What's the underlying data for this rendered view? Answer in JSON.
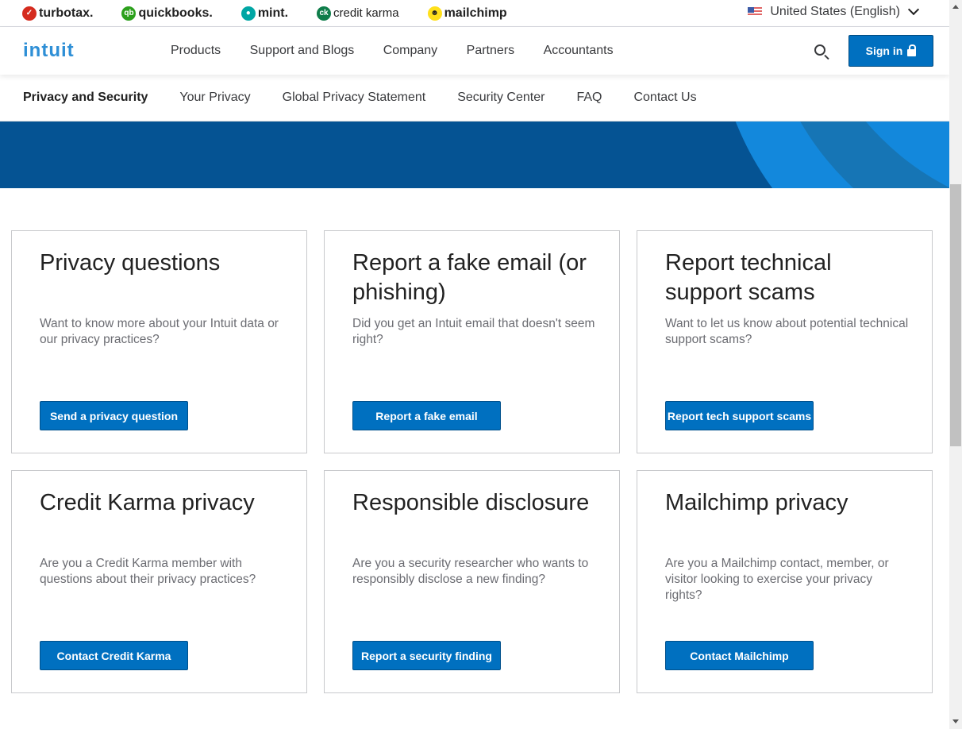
{
  "brands": [
    {
      "label": "turbotax.",
      "color": "#d52b1e",
      "glyph": "✓"
    },
    {
      "label": "quickbooks.",
      "color": "#2ca01c",
      "glyph": "qb"
    },
    {
      "label": "mint.",
      "color": "#00a6a4",
      "glyph": "●"
    },
    {
      "label": "credit karma",
      "color": "#0f7d4a",
      "glyph": "ck"
    },
    {
      "label": "mailchimp",
      "color": "#ffe01b",
      "glyph": "☻"
    }
  ],
  "locale": "United States (English)",
  "header": {
    "logo": "intuit",
    "nav": [
      "Products",
      "Support and Blogs",
      "Company",
      "Partners",
      "Accountants"
    ],
    "signin": "Sign in"
  },
  "subnav": [
    "Privacy and Security",
    "Your Privacy",
    "Global Privacy Statement",
    "Security Center",
    "FAQ",
    "Contact Us"
  ],
  "cards": [
    {
      "title": "Privacy questions",
      "text": "Want to know more about your Intuit data or our privacy practices?",
      "button": "Send a privacy question"
    },
    {
      "title": "Report a fake email (or phishing)",
      "text": "Did you get an Intuit email that doesn't seem right?",
      "button": "Report a fake email"
    },
    {
      "title": "Report technical support scams",
      "text": "Want to let us know about potential technical support scams?",
      "button": "Report tech support scams"
    },
    {
      "title": "Credit Karma privacy",
      "text": "Are you a Credit Karma member with questions about their privacy practices?",
      "button": "Contact Credit Karma"
    },
    {
      "title": "Responsible disclosure",
      "text": "Are you a security researcher who wants to responsibly disclose a new finding?",
      "button": "Report a security finding"
    },
    {
      "title": "Mailchimp privacy",
      "text": "Are you a Mailchimp contact, member, or visitor looking to exercise your privacy rights?",
      "button": "Contact Mailchimp"
    }
  ]
}
